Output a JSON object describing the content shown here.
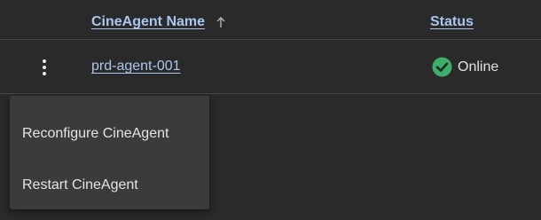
{
  "table": {
    "columns": {
      "name": {
        "label": "CineAgent Name",
        "sort": "ascending",
        "sort_icon": "arrow-up-icon"
      },
      "status": {
        "label": "Status"
      }
    },
    "rows": [
      {
        "name": "prd-agent-001",
        "status": "Online",
        "status_icon": "check-circle-icon",
        "actions_icon": "kebab-menu-icon"
      }
    ]
  },
  "context_menu": {
    "items": [
      {
        "label": "Reconfigure CineAgent"
      },
      {
        "label": "Restart CineAgent"
      }
    ]
  },
  "colors": {
    "background": "#2a2a2a",
    "link": "#a9c7ee",
    "status_online": "#3fae6a",
    "menu_background": "#3b3b3b",
    "divider": "#474747"
  }
}
